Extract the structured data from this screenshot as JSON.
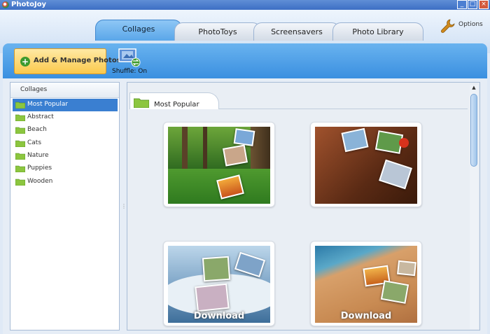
{
  "window": {
    "title": "PhotoJoy",
    "min": "_",
    "max": "□",
    "close": "×"
  },
  "tabs": [
    {
      "label": "Collages",
      "active": true
    },
    {
      "label": "PhotoToys",
      "active": false
    },
    {
      "label": "Screensavers",
      "active": false
    },
    {
      "label": "Photo Library",
      "active": false
    }
  ],
  "options_label": "Options",
  "toolbar": {
    "add_label": "Add & Manage Photos",
    "shuffle_label": "Shuffle: On"
  },
  "sidebar": {
    "heading": "Collages",
    "items": [
      {
        "label": "Most Popular",
        "selected": true
      },
      {
        "label": "Abstract"
      },
      {
        "label": "Beach"
      },
      {
        "label": "Cats"
      },
      {
        "label": "Nature"
      },
      {
        "label": "Puppies"
      },
      {
        "label": "Wooden"
      }
    ]
  },
  "content": {
    "section_title": "Most Popular",
    "thumbnails": [
      {
        "name": "forest",
        "download": ""
      },
      {
        "name": "wooden",
        "download": ""
      },
      {
        "name": "snow-wave",
        "download": "Download"
      },
      {
        "name": "beach",
        "download": "Download"
      }
    ]
  },
  "colors": {
    "accent_blue": "#3a8fe0",
    "selection": "#3a7fd1",
    "add_button": "#fbc94c"
  }
}
